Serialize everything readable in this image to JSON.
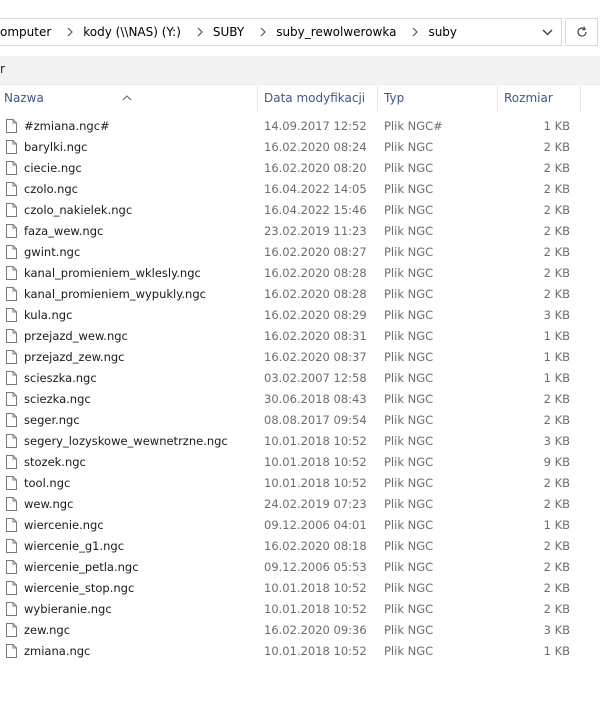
{
  "address_bar": {
    "crumbs": [
      "omputer",
      "kody (\\\\NAS) (Y:)",
      "SUBY",
      "suby_rewolwerowka",
      "suby"
    ]
  },
  "command_bar": {
    "label": "r"
  },
  "columns": {
    "name": "Nazwa",
    "date": "Data modyfikacji",
    "type": "Typ",
    "size": "Rozmiar"
  },
  "files": [
    {
      "name": "#zmiana.ngc#",
      "date": "14.09.2017 12:52",
      "type": "Plik NGC#",
      "size": "1 KB"
    },
    {
      "name": "barylki.ngc",
      "date": "16.02.2020 08:24",
      "type": "Plik NGC",
      "size": "2 KB"
    },
    {
      "name": "ciecie.ngc",
      "date": "16.02.2020 08:20",
      "type": "Plik NGC",
      "size": "2 KB"
    },
    {
      "name": "czolo.ngc",
      "date": "16.04.2022 14:05",
      "type": "Plik NGC",
      "size": "2 KB"
    },
    {
      "name": "czolo_nakielek.ngc",
      "date": "16.04.2022 15:46",
      "type": "Plik NGC",
      "size": "2 KB"
    },
    {
      "name": "faza_wew.ngc",
      "date": "23.02.2019 11:23",
      "type": "Plik NGC",
      "size": "2 KB"
    },
    {
      "name": "gwint.ngc",
      "date": "16.02.2020 08:27",
      "type": "Plik NGC",
      "size": "2 KB"
    },
    {
      "name": "kanal_promieniem_wklesly.ngc",
      "date": "16.02.2020 08:28",
      "type": "Plik NGC",
      "size": "2 KB"
    },
    {
      "name": "kanal_promieniem_wypukly.ngc",
      "date": "16.02.2020 08:28",
      "type": "Plik NGC",
      "size": "2 KB"
    },
    {
      "name": "kula.ngc",
      "date": "16.02.2020 08:29",
      "type": "Plik NGC",
      "size": "3 KB"
    },
    {
      "name": "przejazd_wew.ngc",
      "date": "16.02.2020 08:31",
      "type": "Plik NGC",
      "size": "1 KB"
    },
    {
      "name": "przejazd_zew.ngc",
      "date": "16.02.2020 08:37",
      "type": "Plik NGC",
      "size": "1 KB"
    },
    {
      "name": "scieszka.ngc",
      "date": "03.02.2007 12:58",
      "type": "Plik NGC",
      "size": "1 KB"
    },
    {
      "name": "sciezka.ngc",
      "date": "30.06.2018 08:43",
      "type": "Plik NGC",
      "size": "2 KB"
    },
    {
      "name": "seger.ngc",
      "date": "08.08.2017 09:54",
      "type": "Plik NGC",
      "size": "2 KB"
    },
    {
      "name": "segery_lozyskowe_wewnetrzne.ngc",
      "date": "10.01.2018 10:52",
      "type": "Plik NGC",
      "size": "3 KB"
    },
    {
      "name": "stozek.ngc",
      "date": "10.01.2018 10:52",
      "type": "Plik NGC",
      "size": "9 KB"
    },
    {
      "name": "tool.ngc",
      "date": "10.01.2018 10:52",
      "type": "Plik NGC",
      "size": "2 KB"
    },
    {
      "name": "wew.ngc",
      "date": "24.02.2019 07:23",
      "type": "Plik NGC",
      "size": "2 KB"
    },
    {
      "name": "wiercenie.ngc",
      "date": "09.12.2006 04:01",
      "type": "Plik NGC",
      "size": "1 KB"
    },
    {
      "name": "wiercenie_g1.ngc",
      "date": "16.02.2020 08:18",
      "type": "Plik NGC",
      "size": "2 KB"
    },
    {
      "name": "wiercenie_petla.ngc",
      "date": "09.12.2006 05:53",
      "type": "Plik NGC",
      "size": "2 KB"
    },
    {
      "name": "wiercenie_stop.ngc",
      "date": "10.01.2018 10:52",
      "type": "Plik NGC",
      "size": "2 KB"
    },
    {
      "name": "wybieranie.ngc",
      "date": "10.01.2018 10:52",
      "type": "Plik NGC",
      "size": "2 KB"
    },
    {
      "name": "zew.ngc",
      "date": "16.02.2020 09:36",
      "type": "Plik NGC",
      "size": "3 KB"
    },
    {
      "name": "zmiana.ngc",
      "date": "10.01.2018 10:52",
      "type": "Plik NGC",
      "size": "1 KB"
    }
  ],
  "icons": {
    "breadcrumb_separator": "chevron-right-icon",
    "history_dropdown": "chevron-down-icon",
    "refresh": "refresh-icon",
    "sort": "sort-ascending-icon",
    "file": "file-icon"
  }
}
